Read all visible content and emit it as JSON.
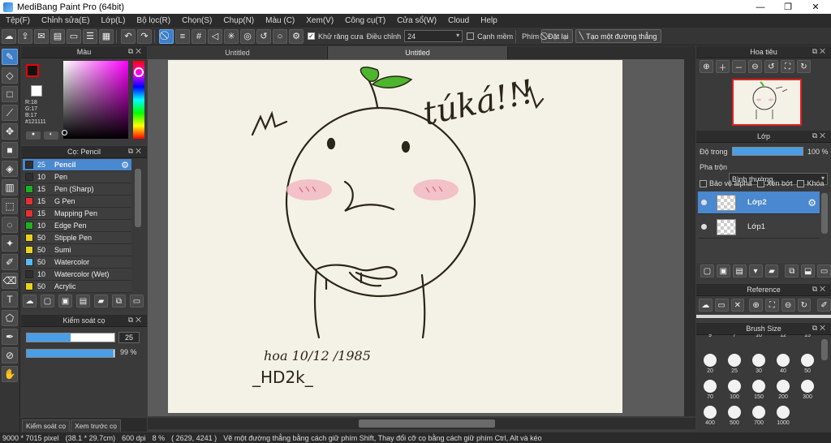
{
  "window": {
    "title": "MediBang Paint Pro (64bit)",
    "minimize": "—",
    "maximize": "❐",
    "close": "✕"
  },
  "menu": [
    "Tệp(F)",
    "Chỉnh sửa(E)",
    "Lớp(L)",
    "Bộ lọc(R)",
    "Chọn(S)",
    "Chụp(N)",
    "Màu (C)",
    "Xem(V)",
    "Công cụ(T)",
    "Cửa sổ(W)",
    "Cloud",
    "Help"
  ],
  "toolbar": {
    "antialias_label": "Khử răng cưa",
    "antialias_checked": true,
    "correction_label": "Điều chỉnh",
    "correction_value": "24",
    "edge_label": "Cạnh mềm",
    "key_label": "Phím",
    "reset_label": "Đặt lại",
    "straight_line_label": "Tạo một đường thẳng"
  },
  "color_panel": {
    "title": "Màu",
    "rgb_r": "R:18",
    "rgb_g": "G:17",
    "rgb_b": "B:17",
    "hex": "#121111",
    "primary_color": "#121111",
    "secondary_color": "#ffffff"
  },
  "brush_panel": {
    "title": "Cọ: Pencil",
    "items": [
      {
        "size": "25",
        "name": "Pencil",
        "color": "#2f2f2f",
        "selected": true
      },
      {
        "size": "10",
        "name": "Pen",
        "color": "#2f2f2f"
      },
      {
        "size": "15",
        "name": "Pen (Sharp)",
        "color": "#1fb01f"
      },
      {
        "size": "15",
        "name": "G Pen",
        "color": "#e63030"
      },
      {
        "size": "15",
        "name": "Mapping Pen",
        "color": "#e63030"
      },
      {
        "size": "10",
        "name": "Edge Pen",
        "color": "#1fb01f"
      },
      {
        "size": "50",
        "name": "Stipple Pen",
        "color": "#e8d21e"
      },
      {
        "size": "50",
        "name": "Sumi",
        "color": "#e8d21e"
      },
      {
        "size": "50",
        "name": "Watercolor",
        "color": "#5ab8f0"
      },
      {
        "size": "10",
        "name": "Watercolor (Wet)",
        "color": "#2f2f2f"
      },
      {
        "size": "50",
        "name": "Acrylic",
        "color": "#e8d21e"
      }
    ]
  },
  "brush_control": {
    "title": "Kiểm soát cọ",
    "size_value": "25",
    "size_fraction": 0.5,
    "opacity_value": "99 %",
    "opacity_fraction": 0.99
  },
  "left_tabs": [
    "Kiểm soát cọ",
    "Xem trước cọ"
  ],
  "document_tabs": [
    "Untitled",
    "Untitled"
  ],
  "canvas_text": {
    "title_handwriting": "túká!!!",
    "signature_line1": "hoa 10/12 /1985",
    "signature_line2": "_HD2k_"
  },
  "navigator": {
    "title": "Hoa tiêu"
  },
  "layer_panel": {
    "title": "Lớp",
    "opacity_label": "Độ trong",
    "opacity_value": "100 %",
    "opacity_fraction": 1.0,
    "blend_label": "Pha trộn",
    "blend_value": "Bình thường",
    "protect_alpha": "Bảo vệ alpha",
    "clipping": "Xén bớt",
    "lock": "Khóa",
    "layers": [
      {
        "name": "Lớp2",
        "selected": true
      },
      {
        "name": "Lớp1",
        "selected": false
      }
    ]
  },
  "reference_panel": {
    "title": "Reference"
  },
  "brush_size_panel": {
    "title": "Brush Size",
    "row0": [
      "9",
      "7",
      "10",
      "12",
      "15"
    ],
    "row1": [
      "20",
      "25",
      "30",
      "40",
      "50"
    ],
    "row2": [
      "70",
      "100",
      "150",
      "200",
      "300"
    ],
    "row3": [
      "400",
      "500",
      "700",
      "1000"
    ]
  },
  "status": {
    "size": "9000 * 7015 pixel",
    "size_cm": "(38.1 * 29.7cm)",
    "dpi": "600 dpi",
    "zoom": "8 %",
    "coords": "( 2629, 4241 )",
    "hint": "Vẽ một đường thẳng bằng cách giữ phím Shift, Thay đổi cỡ cọ bằng cách giữ phím Ctrl, Alt và kéo"
  }
}
